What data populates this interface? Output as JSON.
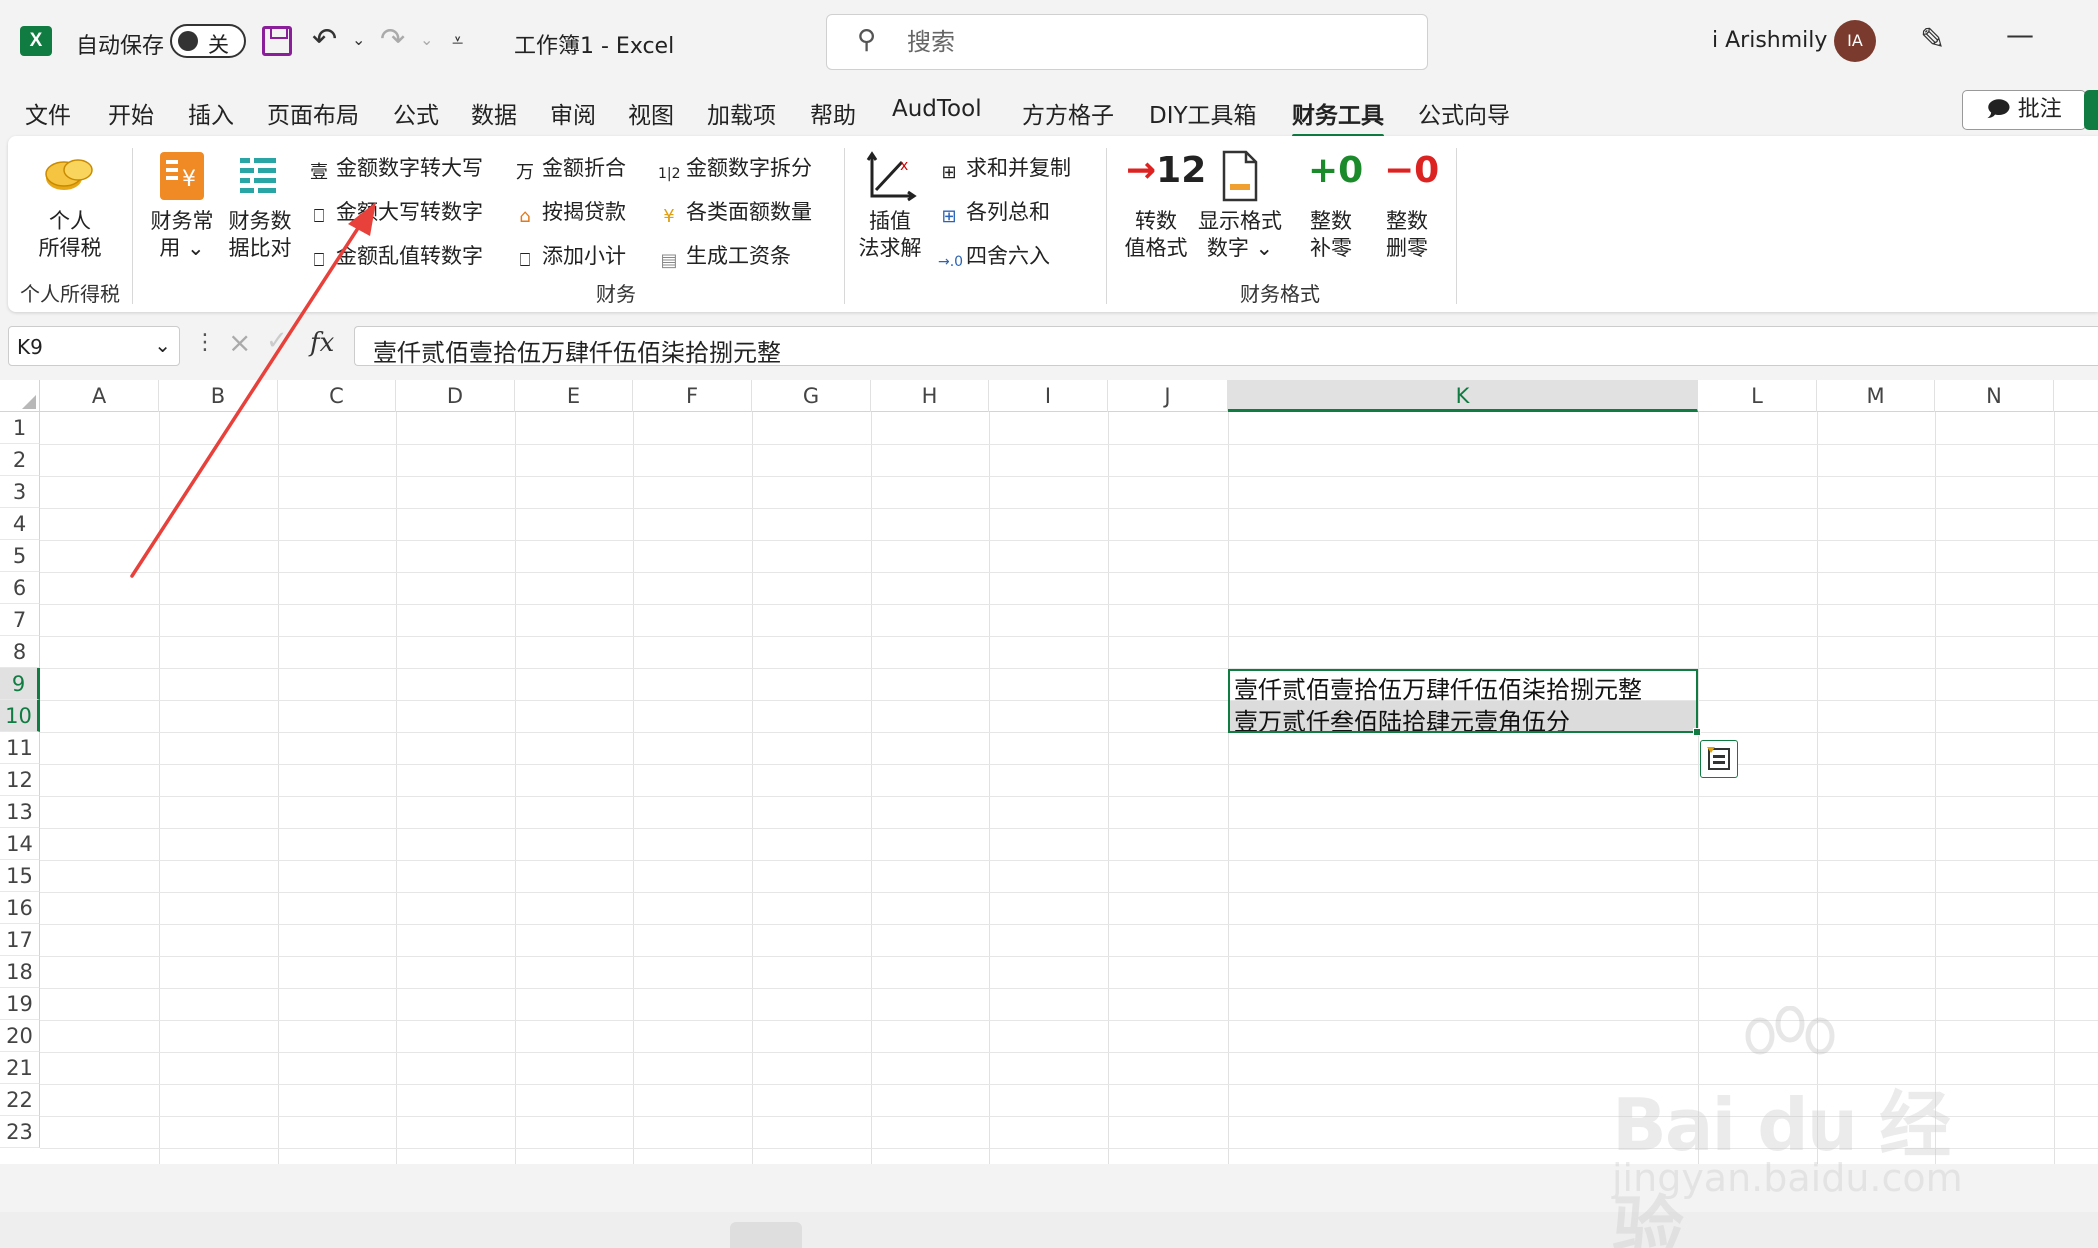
{
  "app": {
    "autosave_label": "自动保存",
    "autosave_state": "关",
    "doc_title": "工作簿1  -  Excel",
    "search_placeholder": "搜索",
    "user_name": "i Arishmily",
    "user_initials": "IA",
    "brand_color": "#107c41"
  },
  "menu": {
    "tabs": [
      "文件",
      "开始",
      "插入",
      "页面布局",
      "公式",
      "数据",
      "审阅",
      "视图",
      "加载项",
      "帮助",
      "AudTool",
      "方方格子",
      "DIY工具箱",
      "财务工具",
      "公式向导"
    ],
    "active_tab": "财务工具",
    "comments_label": "批注"
  },
  "ribbon": {
    "groups": {
      "personal_tax": "个人所得税",
      "finance": "财务",
      "finance_format": "财务格式"
    },
    "big_buttons": {
      "personal_tax": "个人\n所得税",
      "finance_common": "财务常\n用 ⌄",
      "finance_compare": "财务数\n据比对",
      "interpolation": "插值\n法求解",
      "convert_value": "转数\n值格式",
      "display_format": "显示格式\n数字 ⌄",
      "round_up": "整数\n补零",
      "round_delete": "整数\n删零"
    },
    "big_icons": {
      "convert_value": "→12",
      "round_up": "+0",
      "round_delete": "−0"
    },
    "small_buttons": {
      "amount_to_upper": "金额数字转大写",
      "upper_to_amount": "金额大写转数字",
      "garbled_to_number": "金额乱值转数字",
      "amount_discount": "金额折合",
      "mortgage": "按揭贷款",
      "add_subtotal": "添加小计",
      "amount_split": "金额数字拆分",
      "denomination": "各类面额数量",
      "payroll": "生成工资条",
      "sum_copy": "求和并复制",
      "column_totals": "各列总和",
      "round_half": "四舍六入"
    },
    "small_icons": {
      "amount_to_upper": "壹",
      "amount_discount": "万",
      "amount_split": "1|2",
      "denomination": "¥"
    }
  },
  "formula_bar": {
    "name_box": "K9",
    "fx": "fx",
    "formula": "壹仟贰佰壹拾伍万肆仟伍佰柒拾捌元整"
  },
  "grid": {
    "columns": [
      "A",
      "B",
      "C",
      "D",
      "E",
      "F",
      "G",
      "H",
      "I",
      "J",
      "K",
      "L",
      "M",
      "N"
    ],
    "selected_column": "K",
    "rows": [
      "1",
      "2",
      "3",
      "4",
      "5",
      "6",
      "7",
      "8",
      "9",
      "10",
      "11",
      "12",
      "13",
      "14",
      "15",
      "16",
      "17",
      "18",
      "19",
      "20",
      "21",
      "22",
      "23"
    ],
    "selected_rows": [
      "9",
      "10"
    ],
    "cells": {
      "K9": "壹仟贰佰壹拾伍万肆仟伍佰柒拾捌元整",
      "K10": "壹万贰仟叁佰陆拾肆元壹角伍分"
    }
  },
  "watermark": {
    "brand": "Bai du 经验",
    "url": "jingyan.baidu.com"
  }
}
